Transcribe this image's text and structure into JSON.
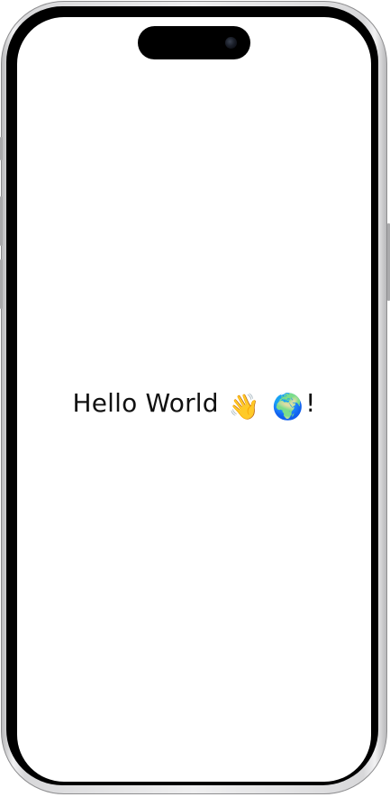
{
  "screen": {
    "greeting_text": "Hello World",
    "wave_emoji": "👋",
    "globe_emoji": "🌍",
    "exclamation": "!"
  },
  "icons": {
    "wave": "waving-hand-icon",
    "globe": "globe-icon"
  },
  "colors": {
    "background": "#ffffff",
    "text": "#111111",
    "bezel": "#000000"
  }
}
